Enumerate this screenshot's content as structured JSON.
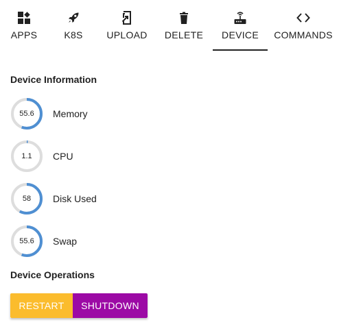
{
  "tabs": [
    {
      "label": "APPS",
      "icon": "apps-icon"
    },
    {
      "label": "K8S",
      "icon": "rocket-icon"
    },
    {
      "label": "UPLOAD",
      "icon": "upload-icon"
    },
    {
      "label": "DELETE",
      "icon": "trash-icon"
    },
    {
      "label": "DEVICE",
      "icon": "router-icon",
      "active": true
    },
    {
      "label": "COMMANDS",
      "icon": "code-icon"
    }
  ],
  "device_info": {
    "title": "Device Information",
    "metrics": [
      {
        "value": "55.6",
        "label": "Memory",
        "percent": 55.6
      },
      {
        "value": "1.1",
        "label": "CPU",
        "percent": 1.1
      },
      {
        "value": "58",
        "label": "Disk Used",
        "percent": 58
      },
      {
        "value": "55.6",
        "label": "Swap",
        "percent": 55.6
      }
    ]
  },
  "device_ops": {
    "title": "Device Operations",
    "restart_label": "RESTART",
    "shutdown_label": "SHUTDOWN"
  },
  "colors": {
    "ring_fill": "#4f8fd2",
    "ring_track": "#dddddd",
    "restart": "#fbbc2d",
    "shutdown": "#9c0aa5"
  }
}
